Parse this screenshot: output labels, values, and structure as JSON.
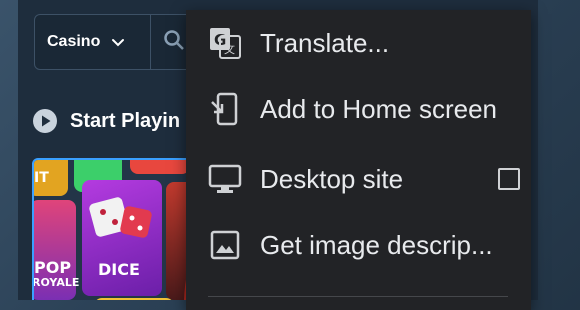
{
  "page": {
    "category_select": {
      "value": "Casino"
    },
    "section": {
      "title": "Start Playin"
    },
    "game_tile": {
      "cards": {
        "dice": "DICE",
        "pop_royale_line1": "POP",
        "pop_royale_line2": "ROYALE",
        "fragment_top": "IT"
      }
    }
  },
  "context_menu": {
    "items": [
      {
        "label": "Translate...",
        "icon": "google-translate-icon"
      },
      {
        "label": "Add to Home screen",
        "icon": "add-to-home-screen-icon"
      },
      {
        "label": "Desktop site",
        "icon": "desktop-icon",
        "checked": false
      },
      {
        "label": "Get image descrip...",
        "icon": "image-icon"
      }
    ]
  },
  "colors": {
    "menu_background": "#222326",
    "app_background": "#1e2d3d",
    "tile_border": "#3aa0ff"
  }
}
